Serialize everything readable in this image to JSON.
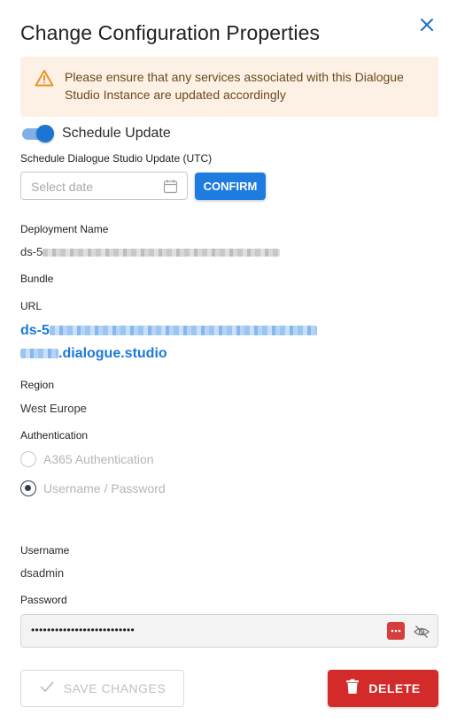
{
  "dialog": {
    "title": "Change Configuration Properties",
    "alert_message": "Please ensure that any services associated with this Dialogue Studio Instance are updated accordingly"
  },
  "schedule": {
    "toggle_label": "Schedule Update",
    "toggle_on": true,
    "field_label": "Schedule Dialogue Studio Update (UTC)",
    "date_placeholder": "Select date",
    "confirm_label": "CONFIRM"
  },
  "deployment": {
    "name_label": "Deployment Name",
    "name_value_prefix": "ds-5",
    "bundle_label": "Bundle",
    "url_label": "URL",
    "url_prefix": "ds-5",
    "url_suffix": ".dialogue.studio",
    "region_label": "Region",
    "region_value": "West Europe"
  },
  "authentication": {
    "label": "Authentication",
    "options": [
      {
        "label": "A365 Authentication",
        "selected": false
      },
      {
        "label": "Username / Password",
        "selected": true
      }
    ]
  },
  "credentials": {
    "username_label": "Username",
    "username_value": "dsadmin",
    "password_label": "Password",
    "password_masked": "••••••••••••••••••••••••••"
  },
  "actions": {
    "save_label": "SAVE CHANGES",
    "delete_label": "DELETE"
  },
  "colors": {
    "primary": "#1e7be0",
    "danger": "#d32a2a",
    "warning_bg": "#fdf0e4",
    "warning_icon": "#e8932a"
  },
  "icons": [
    "close-icon",
    "warning-icon",
    "calendar-icon",
    "password-manager-icon",
    "eye-off-icon",
    "check-icon",
    "trash-icon"
  ]
}
